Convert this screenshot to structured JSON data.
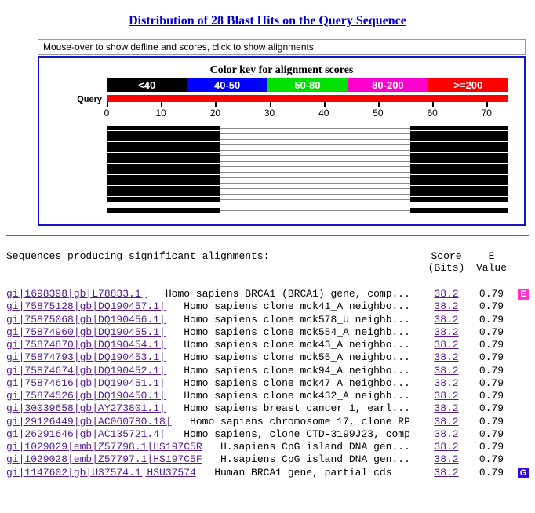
{
  "title": "Distribution of 28 Blast Hits on the Query Sequence",
  "defline_hint": "Mouse-over to show defline and scores, click to show alignments",
  "color_key_title": "Color key for alignment scores",
  "color_key": [
    {
      "label": "<40",
      "bg": "#000000"
    },
    {
      "label": "40-50",
      "bg": "#0000ff"
    },
    {
      "label": "50-80",
      "bg": "#00e000"
    },
    {
      "label": "80-200",
      "bg": "#ff00cc"
    },
    {
      "label": ">=200",
      "bg": "#ff0000"
    }
  ],
  "query_label": "Query",
  "ruler": {
    "min": 0,
    "max": 74,
    "ticks": [
      0,
      10,
      20,
      30,
      40,
      50,
      60,
      70
    ]
  },
  "hits_graphic": [
    {
      "segments": [
        [
          0,
          21
        ],
        [
          56,
          74
        ]
      ]
    },
    {
      "segments": [
        [
          0,
          21
        ],
        [
          56,
          74
        ]
      ]
    },
    {
      "segments": [
        [
          0,
          21
        ],
        [
          56,
          74
        ]
      ]
    },
    {
      "segments": [
        [
          0,
          21
        ],
        [
          56,
          74
        ]
      ]
    },
    {
      "segments": [
        [
          0,
          21
        ],
        [
          56,
          74
        ]
      ]
    },
    {
      "segments": [
        [
          0,
          21
        ],
        [
          56,
          74
        ]
      ]
    },
    {
      "segments": [
        [
          0,
          21
        ],
        [
          56,
          74
        ]
      ]
    },
    {
      "segments": [
        [
          0,
          21
        ],
        [
          56,
          74
        ]
      ]
    },
    {
      "segments": [
        [
          0,
          21
        ],
        [
          56,
          74
        ]
      ]
    },
    {
      "segments": [
        [
          0,
          21
        ],
        [
          56,
          74
        ]
      ]
    },
    {
      "segments": [
        [
          0,
          21
        ],
        [
          56,
          74
        ]
      ]
    },
    {
      "segments": [
        [
          0,
          21
        ],
        [
          56,
          74
        ]
      ]
    },
    {
      "segments": [
        [
          0,
          21
        ],
        [
          56,
          74
        ]
      ]
    },
    {
      "segments": [
        [
          0,
          21
        ],
        [
          56,
          74
        ]
      ]
    },
    {
      "segments": []
    },
    {
      "segments": [
        [
          0,
          21
        ],
        [
          56,
          74
        ]
      ]
    }
  ],
  "table_header": {
    "desc": "Sequences producing significant alignments:",
    "score_label_1": "Score",
    "score_label_2": "(Bits)",
    "eval_label_1": "E",
    "eval_label_2": "Value"
  },
  "hits": [
    {
      "accession": "gi|1698398|gb|L78833.1|",
      "desc": "Homo sapiens BRCA1 (BRCA1) gene, comp...",
      "score": "38.2",
      "evalue": "0.79",
      "badge": "E"
    },
    {
      "accession": "gi|75875128|gb|DQ190457.1|",
      "desc": "Homo sapiens clone mck41_A neighbo...",
      "score": "38.2",
      "evalue": "0.79"
    },
    {
      "accession": "gi|75875068|gb|DQ190456.1|",
      "desc": "Homo sapiens clone mck578_U neighb...",
      "score": "38.2",
      "evalue": "0.79"
    },
    {
      "accession": "gi|75874960|gb|DQ190455.1|",
      "desc": "Homo sapiens clone mck554_A neighb...",
      "score": "38.2",
      "evalue": "0.79"
    },
    {
      "accession": "gi|75874870|gb|DQ190454.1|",
      "desc": "Homo sapiens clone mck43_A neighbo...",
      "score": "38.2",
      "evalue": "0.79"
    },
    {
      "accession": "gi|75874793|gb|DQ190453.1|",
      "desc": "Homo sapiens clone mck55_A neighbo...",
      "score": "38.2",
      "evalue": "0.79"
    },
    {
      "accession": "gi|75874674|gb|DQ190452.1|",
      "desc": "Homo sapiens clone mck94_A neighbo...",
      "score": "38.2",
      "evalue": "0.79"
    },
    {
      "accession": "gi|75874616|gb|DQ190451.1|",
      "desc": "Homo sapiens clone mck47_A neighbo...",
      "score": "38.2",
      "evalue": "0.79"
    },
    {
      "accession": "gi|75874526|gb|DQ190450.1|",
      "desc": "Homo sapiens clone mck432_A neighb...",
      "score": "38.2",
      "evalue": "0.79"
    },
    {
      "accession": "gi|30039658|gb|AY273801.1|",
      "desc": "Homo sapiens breast cancer 1, earl...",
      "score": "38.2",
      "evalue": "0.79"
    },
    {
      "accession": "gi|29126449|gb|AC060780.18|",
      "desc": "Homo sapiens chromosome 17, clone RP",
      "score": "38.2",
      "evalue": "0.79"
    },
    {
      "accession": "gi|26291646|gb|AC135721.4|",
      "desc": "Homo sapiens, clone CTD-3199J23, comp",
      "score": "38.2",
      "evalue": "0.79"
    },
    {
      "accession": "gi|1029029|emb|Z57798.1|HS197C5R",
      "desc": "H.sapiens CpG island DNA gen...",
      "score": "38.2",
      "evalue": "0.79"
    },
    {
      "accession": "gi|1029028|emb|Z57797.1|HS197C5F",
      "desc": "H.sapiens CpG island DNA gen...",
      "score": "38.2",
      "evalue": "0.79"
    },
    {
      "accession": "gi|1147602|gb|U37574.1|HSU37574",
      "desc": "Human BRCA1 gene, partial cds",
      "score": "38.2",
      "evalue": "0.79",
      "badge": "G"
    }
  ]
}
